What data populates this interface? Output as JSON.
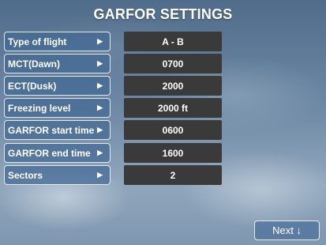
{
  "title": "GARFOR SETTINGS",
  "rows": [
    {
      "label": "Type of flight",
      "value": "A - B",
      "arrow": "▶"
    },
    {
      "label": "MCT(Dawn)",
      "value": "0700",
      "arrow": "▶"
    },
    {
      "label": "ECT(Dusk)",
      "value": "2000",
      "arrow": "▶"
    },
    {
      "label": "Freezing level",
      "value": "2000 ft",
      "arrow": "▶"
    },
    {
      "label": "GARFOR start time",
      "value": "0600",
      "arrow": "▶"
    },
    {
      "label": "GARFOR end time",
      "value": "1600",
      "arrow": "▶"
    },
    {
      "label": "Sectors",
      "value": "2",
      "arrow": "▶"
    }
  ],
  "next_label": "Next ↓"
}
